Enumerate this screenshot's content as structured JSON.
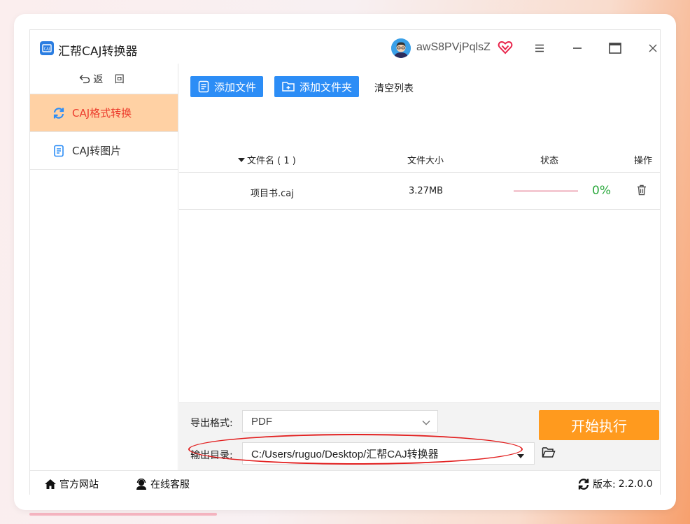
{
  "app": {
    "title": "汇帮CAJ转换器"
  },
  "user": {
    "name": "awS8PVjPqlsZ"
  },
  "sidebar": {
    "back_label": "返 回",
    "items": [
      {
        "label": "CAJ格式转换",
        "icon": "refresh-icon",
        "active": true
      },
      {
        "label": "CAJ转图片",
        "icon": "document-icon",
        "active": false
      }
    ]
  },
  "toolbar": {
    "add_file_label": "添加文件",
    "add_folder_label": "添加文件夹",
    "clear_list_label": "清空列表"
  },
  "table": {
    "headers": {
      "name": "文件名 ( 1 )",
      "size": "文件大小",
      "status": "状态",
      "actions": "操作"
    },
    "rows": [
      {
        "name": "项目书.caj",
        "size": "3.27MB",
        "progress_percent": 0,
        "progress_label": "0%"
      }
    ]
  },
  "output": {
    "format_label": "导出格式:",
    "format_value": "PDF",
    "dir_label": "输出目录:",
    "dir_value": "C:/Users/ruguo/Desktop/汇帮CAJ转换器",
    "start_label": "开始执行"
  },
  "footer": {
    "website_label": "官方网站",
    "support_label": "在线客服",
    "version_label": "版本:",
    "version_value": "2.2.0.0"
  },
  "colors": {
    "accent_blue": "#2c8df6",
    "active_nav_bg": "#ffd1a4",
    "active_nav_text": "#ec3b2c",
    "start_button": "#ff9a1e",
    "progress_green": "#2aa83c",
    "annotation_red": "#e21f1f"
  }
}
